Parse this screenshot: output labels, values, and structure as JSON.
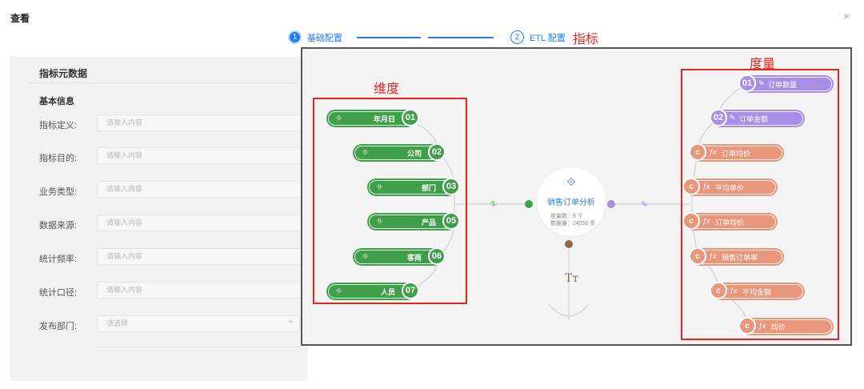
{
  "dialog": {
    "title": "查看",
    "close": "×"
  },
  "steps": [
    {
      "num": "1",
      "label": "基础配置"
    },
    {
      "num": "2",
      "label": "ETL 配置"
    }
  ],
  "annotations": {
    "indicator": "指标",
    "dimension": "维度",
    "measure": "度量"
  },
  "form": {
    "section_title": "指标元数据",
    "basic_info": "基本信息",
    "fields": [
      {
        "label": "指标定义:",
        "placeholder": "请输入内容"
      },
      {
        "label": "指标目的:",
        "placeholder": "请输入内容"
      },
      {
        "label": "业务类型:",
        "placeholder": "请输入内容"
      },
      {
        "label": "数据来源:",
        "placeholder": "请输入内容"
      },
      {
        "label": "统计频率:",
        "placeholder": "请输入内容"
      },
      {
        "label": "统计口径:",
        "placeholder": "请输入内容"
      }
    ],
    "publish_dept": {
      "label": "发布部门:",
      "placeholder": "请选择"
    }
  },
  "dimensions": [
    {
      "label": "年月日",
      "num": "01"
    },
    {
      "label": "公司",
      "num": "02"
    },
    {
      "label": "部门",
      "num": "03"
    },
    {
      "label": "产品",
      "num": "05"
    },
    {
      "label": "客商",
      "num": "06"
    },
    {
      "label": "人员",
      "num": "07"
    }
  ],
  "measures": [
    {
      "badge": "01",
      "label": "订单数量",
      "kind": "field"
    },
    {
      "badge": "02",
      "label": "订单金额",
      "kind": "field"
    },
    {
      "badge": "c",
      "label": "订单均价",
      "kind": "calc"
    },
    {
      "badge": "c",
      "label": "平均单价",
      "kind": "calc"
    },
    {
      "badge": "c",
      "label": "订单均价",
      "kind": "calc"
    },
    {
      "badge": "c",
      "label": "销售订单率",
      "kind": "calc"
    },
    {
      "badge": "c",
      "label": "平均金额",
      "kind": "calc"
    },
    {
      "badge": "c",
      "label": "均价",
      "kind": "calc"
    }
  ],
  "center": {
    "name": "销售订单分析",
    "measure_count": "度量数：8 个",
    "data_volume": "数据量：24250 条"
  },
  "icons": {
    "dimension": "dimension-icon",
    "measure_field": "ruler-icon",
    "measure_calc": "fx-icon",
    "center": "link-icon",
    "text": "text-icon"
  },
  "colors": {
    "primary": "#1f7bff",
    "dimension": "#3f9f4a",
    "measure_field": "#a88ee6",
    "measure_calc": "#e8977c",
    "annotation": "#e8251f"
  }
}
